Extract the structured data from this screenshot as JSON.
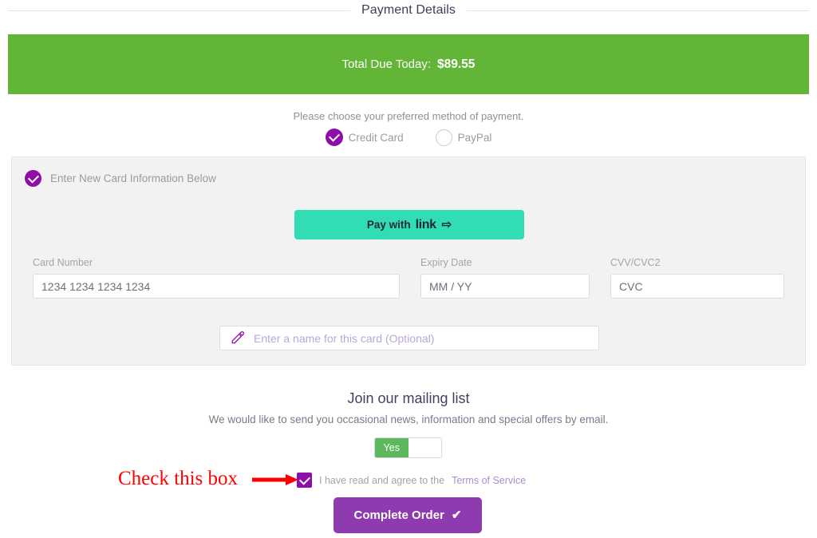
{
  "section": {
    "title": "Payment Details"
  },
  "total": {
    "label": "Total Due Today:",
    "amount": "$89.55",
    "bar_color": "#62b536"
  },
  "payment_method": {
    "help_text": "Please choose your preferred method of payment.",
    "options": [
      {
        "label": "Credit Card",
        "selected": true,
        "icon": "radio-checked-icon"
      },
      {
        "label": "PayPal",
        "selected": false,
        "icon": "radio-empty-icon"
      }
    ]
  },
  "card_panel": {
    "header_label": "Enter New Card Information Below",
    "header_icon": "check-circle-icon",
    "link_button": {
      "prefix": "Pay with",
      "brand": "link",
      "arrow": "⇨",
      "color": "#33ddb3"
    },
    "fields": [
      {
        "name": "card-number",
        "label": "Card Number",
        "placeholder": "1234 1234 1234 1234",
        "value": ""
      },
      {
        "name": "expiry-date",
        "label": "Expiry Date",
        "placeholder": "MM / YY",
        "value": ""
      },
      {
        "name": "cvv",
        "label": "CVV/CVC2",
        "placeholder": "CVC",
        "value": ""
      }
    ],
    "nickname": {
      "placeholder": "Enter a name for this card (Optional)",
      "value": "",
      "icon": "pencil-icon"
    }
  },
  "mailing_list": {
    "title": "Join our mailing list",
    "subtitle": "We would like to send you occasional news, information and special offers by email.",
    "toggle": {
      "on_label": "Yes",
      "state": "on",
      "on_color": "#5cb85c"
    }
  },
  "annotation": {
    "text": "Check this box",
    "color": "#ff0000",
    "arrow_icon": "right-arrow-icon"
  },
  "terms": {
    "checkbox_checked": true,
    "checkbox_color": "#8e0fa6",
    "text": "I have read and agree to the",
    "link_text": "Terms of Service"
  },
  "submit": {
    "label": "Complete Order",
    "tick": "✔",
    "color": "#8e3bb0"
  }
}
